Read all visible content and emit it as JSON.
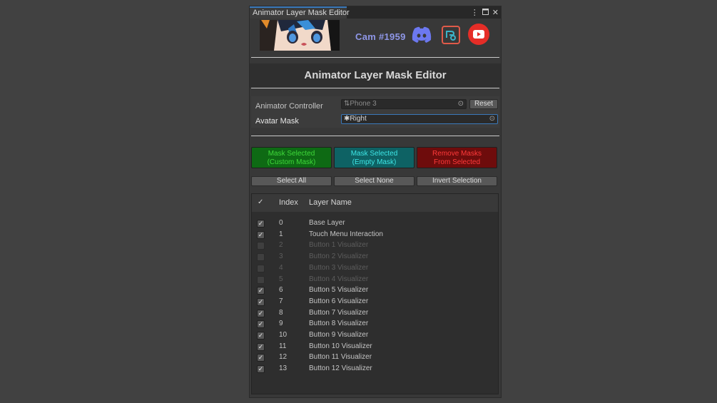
{
  "window": {
    "tab_title": "Animator Layer Mask Editor",
    "menu_icon": "kebab-menu-icon",
    "maximize_icon": "maximize-icon",
    "close_icon": "close-icon"
  },
  "header": {
    "cam_label": "Cam #1959",
    "links": [
      "discord-icon",
      "booth-icon",
      "youtube-icon"
    ],
    "colors": {
      "cam": "#8f97e8",
      "discord": "#5865f2",
      "booth": "#e05a49",
      "youtube": "#e52d27"
    }
  },
  "title": "Animator Layer Mask Editor",
  "fields": {
    "controller_label": "Animator Controller",
    "controller_value": "Phone 3",
    "reset_label": "Reset",
    "mask_label": "Avatar Mask",
    "mask_value": "Right"
  },
  "actions": {
    "mask_custom": [
      "Mask Selected",
      "(Custom Mask)"
    ],
    "mask_empty": [
      "Mask Selected",
      "(Empty Mask)"
    ],
    "remove": [
      "Remove Masks",
      "From Selected"
    ],
    "select_all": "Select All",
    "select_none": "Select None",
    "invert": "Invert Selection"
  },
  "table": {
    "check_header": "✓",
    "index_header": "Index",
    "name_header": "Layer Name",
    "rows": [
      {
        "index": "0",
        "name": "Base Layer",
        "checked": true
      },
      {
        "index": "1",
        "name": "Touch Menu Interaction",
        "checked": true
      },
      {
        "index": "2",
        "name": "Button 1 Visualizer",
        "checked": false
      },
      {
        "index": "3",
        "name": "Button 2 Visualizer",
        "checked": false
      },
      {
        "index": "4",
        "name": "Button 3 Visualizer",
        "checked": false
      },
      {
        "index": "5",
        "name": "Button 4 Visualizer",
        "checked": false
      },
      {
        "index": "6",
        "name": "Button 5 Visualizer",
        "checked": true
      },
      {
        "index": "7",
        "name": "Button 6 Visualizer",
        "checked": true
      },
      {
        "index": "8",
        "name": "Button 7 Visualizer",
        "checked": true
      },
      {
        "index": "9",
        "name": "Button 8 Visualizer",
        "checked": true
      },
      {
        "index": "10",
        "name": "Button 9 Visualizer",
        "checked": true
      },
      {
        "index": "11",
        "name": "Button 10 Visualizer",
        "checked": true
      },
      {
        "index": "12",
        "name": "Button 11 Visualizer",
        "checked": true
      },
      {
        "index": "13",
        "name": "Button 12 Visualizer",
        "checked": true
      }
    ]
  }
}
